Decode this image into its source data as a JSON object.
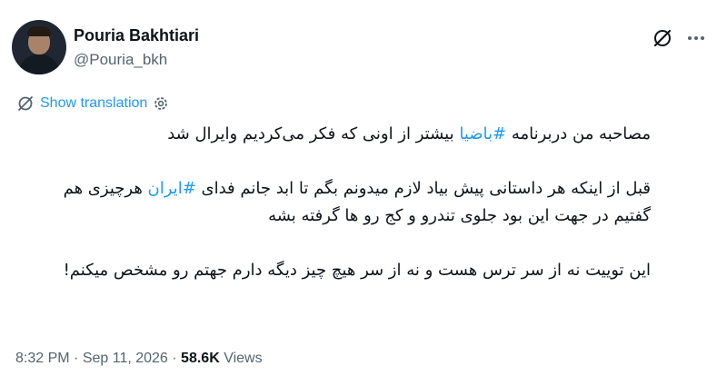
{
  "author": {
    "name": "Pouria Bakhtiari",
    "handle": "@Pouria_bkh"
  },
  "icons": {
    "grok": "grok-icon",
    "more": "more-icon",
    "translate": "translate-icon",
    "settings": "gear-icon"
  },
  "translation": {
    "label": "Show translation"
  },
  "tweet": {
    "line1_a": "مصاحبه من دربرنامه ",
    "line1_tag": "#باضیا",
    "line1_b": " بیشتر از اونی که فکر می‌کردیم وایرال شد",
    "para2_a": "قبل از اینکه هر داستانی پیش بیاد لازم میدونم بگم تا ابد جانم فدای ",
    "para2_tag": "#ایران",
    "para2_b": " هرچیزی هم گفتیم در جهت این بود جلوی تندرو و کج رو ها گرفته بشه",
    "para3": "این توییت نه از سر ترس هست و نه از سر هیچ چیز دیگه دارم جهتم رو مشخص میکنم!"
  },
  "meta": {
    "time": "8:32 PM",
    "sep": " · ",
    "date": "Sep 11, 2026",
    "views_count": "58.6K",
    "views_label": " Views"
  },
  "colors": {
    "accent": "#1d9bf0",
    "text": "#0f1419",
    "muted": "#536471"
  }
}
